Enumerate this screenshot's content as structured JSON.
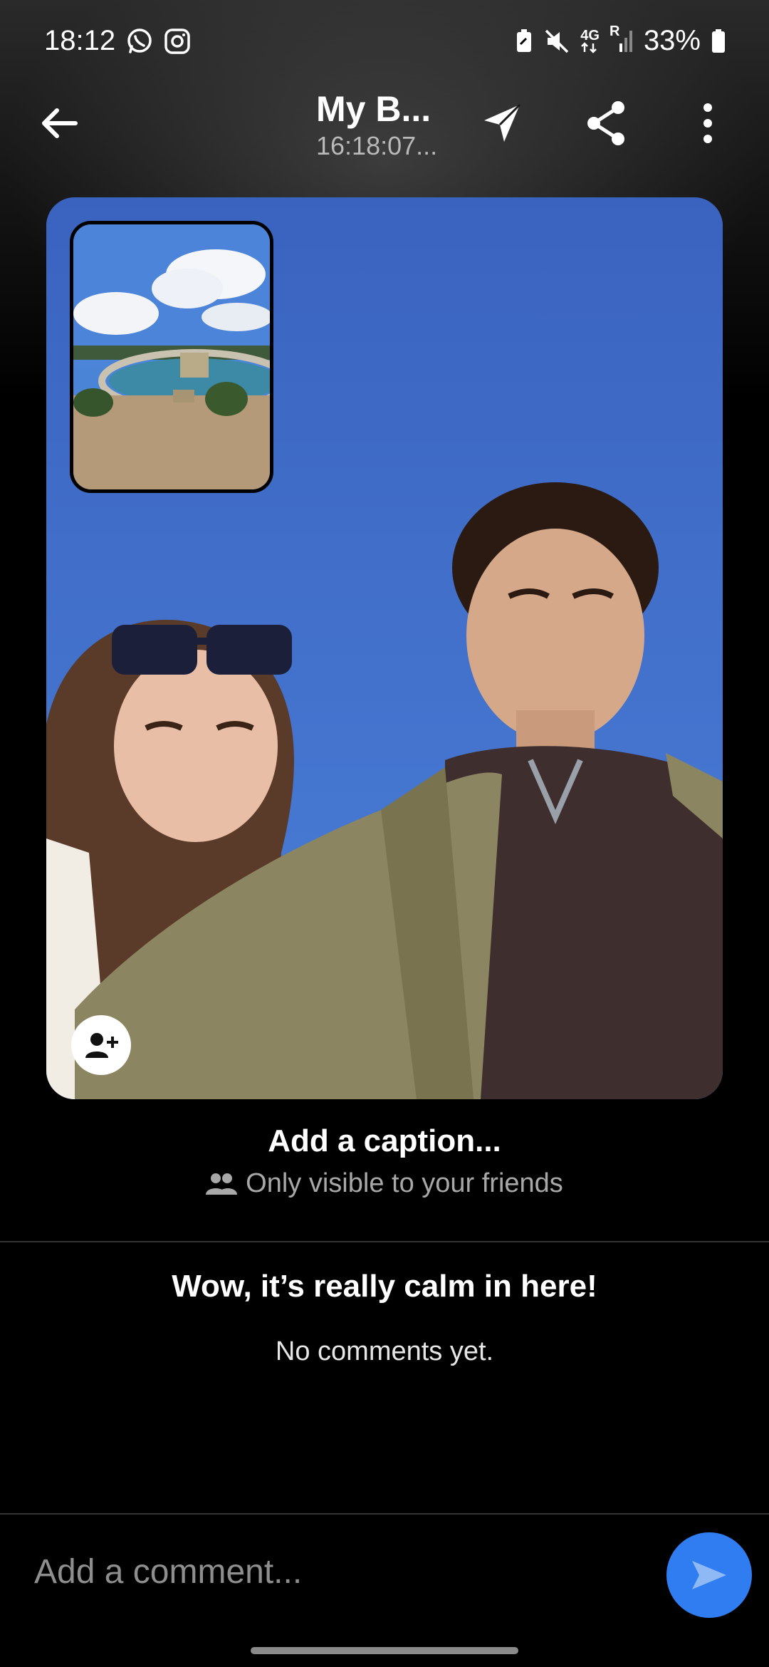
{
  "status_bar": {
    "time": "18:12",
    "battery": "33%",
    "network": "4G",
    "roaming": "R",
    "icons": [
      "whatsapp-icon",
      "instagram-icon",
      "battery-saver-icon",
      "mute-icon",
      "signal-icon",
      "battery-icon"
    ]
  },
  "header": {
    "title": "My B...",
    "subtitle": "16:18:07...",
    "icons": [
      "back-arrow-icon",
      "send-icon",
      "share-icon",
      "more-vertical-icon"
    ]
  },
  "post": {
    "caption_prompt": "Add a caption...",
    "visibility_text": "Only visible to your friends",
    "tag_icon": "add-person-icon"
  },
  "comments": {
    "empty_title": "Wow, it’s really calm in here!",
    "empty_subtitle": "No comments yet."
  },
  "comment_bar": {
    "placeholder": "Add a comment...",
    "send_icon": "send-arrow-icon"
  },
  "colors": {
    "accent": "#2f7df0",
    "background": "#000000",
    "muted_text": "#a8a8a8"
  }
}
